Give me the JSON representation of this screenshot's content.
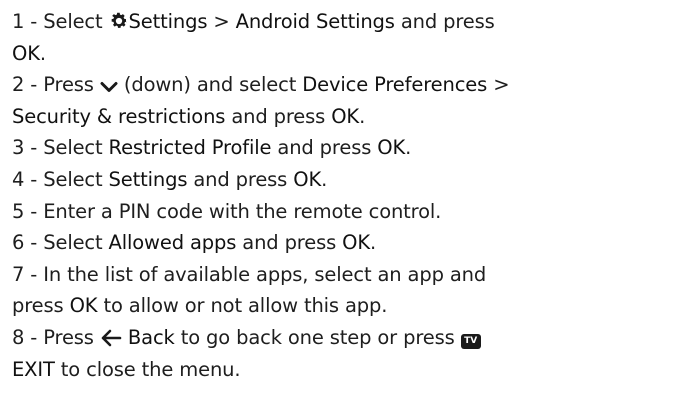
{
  "steps": [
    {
      "lines": [
        [
          {
            "t": "1 -  Select  "
          },
          {
            "icon": "gear-icon"
          },
          {
            "t": "Settings",
            "b": true
          },
          {
            "t": " >  "
          },
          {
            "t": "Android Settings",
            "b": true
          },
          {
            "t": " and press"
          }
        ],
        [
          {
            "t": "OK",
            "b": true
          },
          {
            "t": "."
          }
        ]
      ]
    },
    {
      "lines": [
        [
          {
            "t": "2 -  Press "
          },
          {
            "icon": "chevron-down-icon"
          },
          {
            "t": " (down) and select  "
          },
          {
            "t": "Device Preferences",
            "b": true
          },
          {
            "t": " >"
          }
        ],
        [
          {
            "t": "Security & restrictions",
            "b": true
          },
          {
            "t": " and press "
          },
          {
            "t": "OK",
            "b": true
          },
          {
            "t": "."
          }
        ]
      ]
    },
    {
      "lines": [
        [
          {
            "t": "3 -  Select "
          },
          {
            "t": "Restricted Profile",
            "b": true
          },
          {
            "t": " and press "
          },
          {
            "t": "OK",
            "b": true
          },
          {
            "t": "."
          }
        ]
      ]
    },
    {
      "lines": [
        [
          {
            "t": "4 -  Select "
          },
          {
            "t": "Settings",
            "b": true
          },
          {
            "t": " and press "
          },
          {
            "t": "OK",
            "b": true
          },
          {
            "t": "."
          }
        ]
      ]
    },
    {
      "lines": [
        [
          {
            "t": "5 -  Enter a PIN code with the remote control."
          }
        ]
      ]
    },
    {
      "lines": [
        [
          {
            "t": "6 -  Select "
          },
          {
            "t": "Allowed apps",
            "b": true
          },
          {
            "t": " and press "
          },
          {
            "t": "OK",
            "b": true
          },
          {
            "t": "."
          }
        ]
      ]
    },
    {
      "lines": [
        [
          {
            "t": "7 -  In the list of available apps, select an app and"
          }
        ],
        [
          {
            "t": "press "
          },
          {
            "t": "OK",
            "b": true
          },
          {
            "t": " to allow or not allow this app."
          }
        ]
      ]
    },
    {
      "lines": [
        [
          {
            "t": "8 -  Press  "
          },
          {
            "icon": "back-arrow-icon"
          },
          {
            "t": "  "
          },
          {
            "t": "Back",
            "b": true
          },
          {
            "t": " to go back one step or press  "
          },
          {
            "icon": "tv-icon",
            "label": "TV"
          }
        ],
        [
          {
            "t": "EXIT",
            "b": true
          },
          {
            "t": " to close the menu."
          }
        ]
      ]
    }
  ]
}
